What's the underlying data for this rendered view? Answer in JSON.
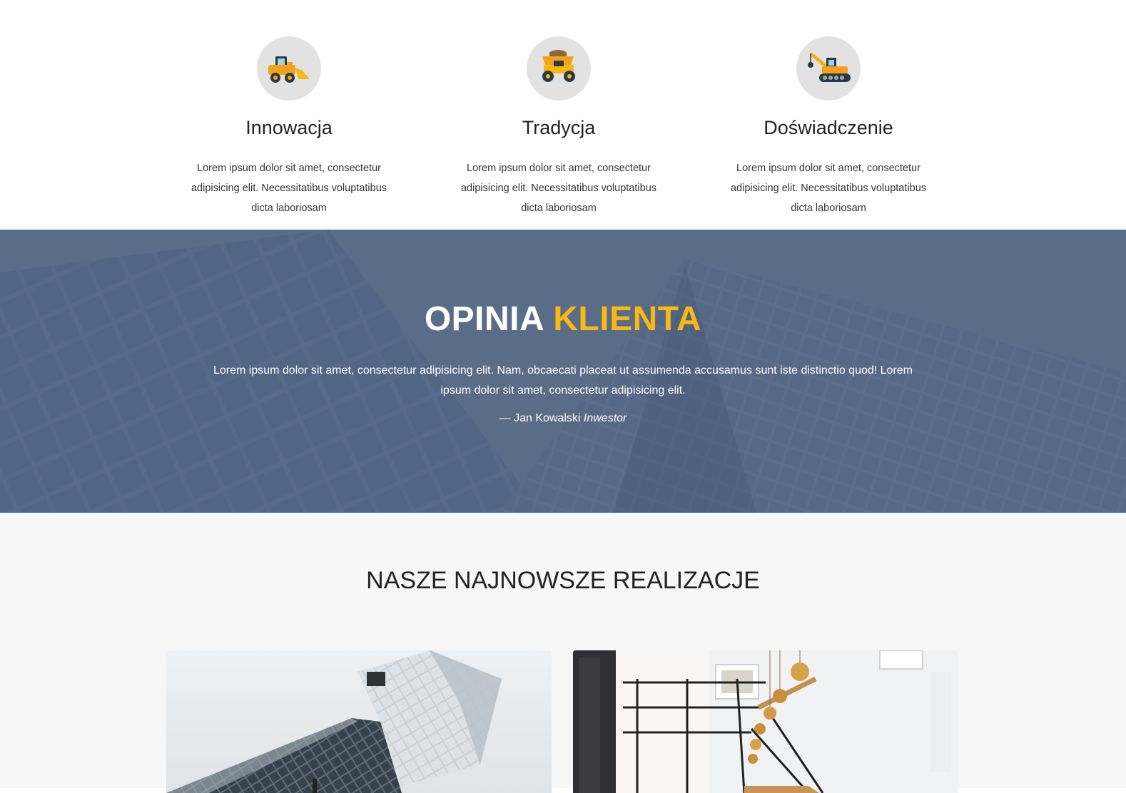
{
  "features": [
    {
      "icon": "bulldozer-icon",
      "title": "Innowacja",
      "text": "Lorem ipsum dolor sit amet, consectetur adipisicing elit. Necessitatibus voluptatibus dicta laboriosam"
    },
    {
      "icon": "dump-truck-icon",
      "title": "Tradycja",
      "text": "Lorem ipsum dolor sit amet, consectetur adipisicing elit. Necessitatibus voluptatibus dicta laboriosam"
    },
    {
      "icon": "crane-icon",
      "title": "Doświadczenie",
      "text": "Lorem ipsum dolor sit amet, consectetur adipisicing elit. Necessitatibus voluptatibus dicta laboriosam"
    }
  ],
  "testimonial": {
    "title_main": "OPINIA",
    "title_accent": "KLIENTA",
    "quote": "Lorem ipsum dolor sit amet, consectetur adipisicing elit. Nam, obcaecati placeat ut assumenda accusamus sunt iste distinctio quod! Lorem ipsum dolor sit amet, consectetur adipisicing elit.",
    "author_name": "— Jan Kowalski",
    "author_role": "Inwestor"
  },
  "projects": {
    "title": "NASZE NAJNOWSZE REALIZACJE",
    "items": [
      {
        "image": "modern-building-photo"
      },
      {
        "image": "staircase-interior-photo"
      }
    ]
  },
  "colors": {
    "accent": "#f7b914",
    "overlay": "#5a6c88",
    "icon_circle": "#e2e2e2",
    "section_bg": "#f7f7f7"
  }
}
